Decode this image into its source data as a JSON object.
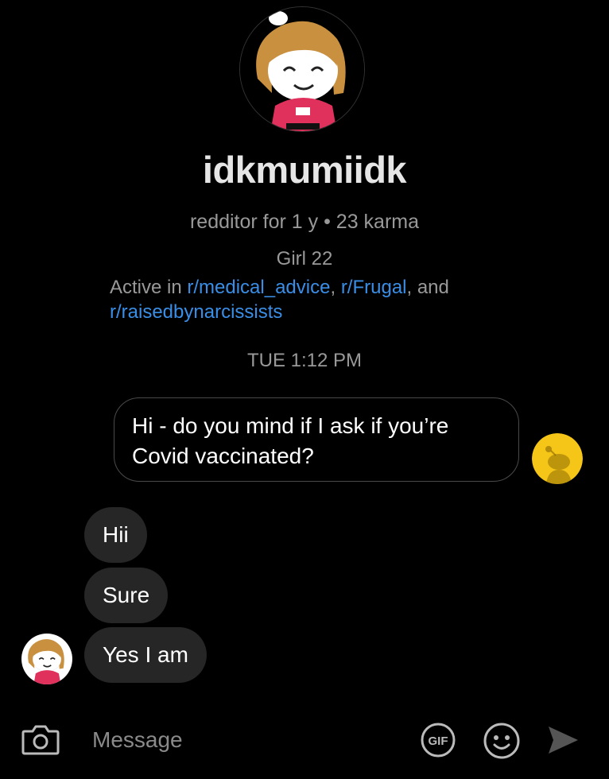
{
  "profile": {
    "username": "idkmumiidk",
    "meta": "redditor for 1 y • 23 karma",
    "bio": "Girl 22",
    "active_in": {
      "prefix": "Active in ",
      "communities": [
        "r/medical_advice",
        "r/Frugal",
        "r/raisedbynarcissists"
      ],
      "sep1": ", ",
      "sep2": ", and"
    },
    "avatar_icon": "snoo-avatar-girl"
  },
  "conversation": {
    "timestamp": "TUE 1:12 PM",
    "sent_messages": [
      {
        "text": "Hi - do you mind if I ask if you’re Covid vaccinated?"
      }
    ],
    "received_messages": [
      {
        "text": "Hii"
      },
      {
        "text": "Sure"
      },
      {
        "text": "Yes I am"
      }
    ]
  },
  "composer": {
    "placeholder": "Message",
    "icons": [
      "camera-icon",
      "gif-icon",
      "emoji-icon",
      "send-icon"
    ]
  },
  "colors": {
    "background": "#000000",
    "link": "#3a8ee6",
    "received_bubble": "#262626",
    "sent_bubble_border": "#4a4a4a",
    "my_avatar": "#f5c518",
    "muted_text": "#999999"
  }
}
